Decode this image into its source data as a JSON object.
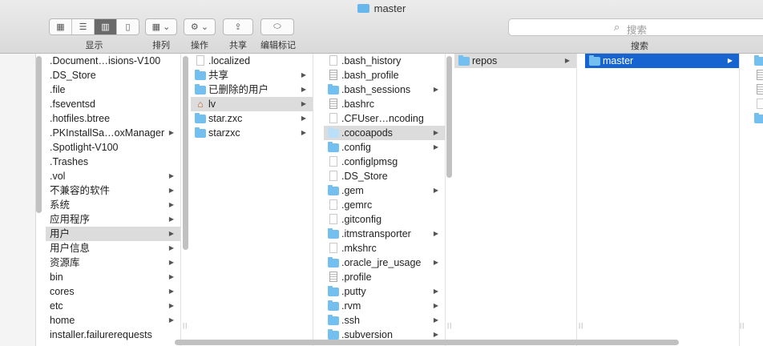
{
  "window": {
    "title": "master"
  },
  "toolbar": {
    "view_label": "显示",
    "arrange_label": "排列",
    "action_label": "操作",
    "share_label": "共享",
    "tags_label": "编辑标记",
    "search_placeholder": "搜索",
    "search_label": "搜索"
  },
  "columns": [
    {
      "items": [
        {
          "label": ".Document…isions-V100",
          "arrow": false
        },
        {
          "label": ".DS_Store",
          "arrow": false
        },
        {
          "label": ".file",
          "arrow": false
        },
        {
          "label": ".fseventsd",
          "arrow": false
        },
        {
          "label": ".hotfiles.btree",
          "arrow": false
        },
        {
          "label": ".PKInstallSa…oxManager",
          "arrow": true
        },
        {
          "label": ".Spotlight-V100",
          "arrow": false
        },
        {
          "label": ".Trashes",
          "arrow": false
        },
        {
          "label": ".vol",
          "arrow": true
        },
        {
          "label": "不兼容的软件",
          "arrow": true
        },
        {
          "label": "系统",
          "arrow": true
        },
        {
          "label": "应用程序",
          "arrow": true
        },
        {
          "label": "用户",
          "arrow": true,
          "state": "sel"
        },
        {
          "label": "用户信息",
          "arrow": true
        },
        {
          "label": "资源库",
          "arrow": true
        },
        {
          "label": "bin",
          "arrow": true
        },
        {
          "label": "cores",
          "arrow": true
        },
        {
          "label": "etc",
          "arrow": true
        },
        {
          "label": "home",
          "arrow": true
        },
        {
          "label": "installer.failurerequests",
          "arrow": false
        }
      ]
    },
    {
      "items": [
        {
          "label": ".localized",
          "icon": "file",
          "arrow": false
        },
        {
          "label": "共享",
          "icon": "folder",
          "arrow": true
        },
        {
          "label": "已删除的用户",
          "icon": "folder",
          "arrow": true
        },
        {
          "label": "lv",
          "icon": "home",
          "arrow": true,
          "state": "sel"
        },
        {
          "label": "star.zxc",
          "icon": "folder",
          "arrow": true
        },
        {
          "label": "starzxc",
          "icon": "folder",
          "arrow": true
        }
      ]
    },
    {
      "items": [
        {
          "label": ".bash_history",
          "icon": "file",
          "arrow": false
        },
        {
          "label": ".bash_profile",
          "icon": "doc",
          "arrow": false
        },
        {
          "label": ".bash_sessions",
          "icon": "folder",
          "arrow": true
        },
        {
          "label": ".bashrc",
          "icon": "doc",
          "arrow": false
        },
        {
          "label": ".CFUser…ncoding",
          "icon": "file",
          "arrow": false
        },
        {
          "label": ".cocoapods",
          "icon": "pale",
          "arrow": true,
          "state": "sel"
        },
        {
          "label": ".config",
          "icon": "folder",
          "arrow": true
        },
        {
          "label": ".configlpmsg",
          "icon": "file",
          "arrow": false
        },
        {
          "label": ".DS_Store",
          "icon": "file",
          "arrow": false
        },
        {
          "label": ".gem",
          "icon": "folder",
          "arrow": true
        },
        {
          "label": ".gemrc",
          "icon": "file",
          "arrow": false
        },
        {
          "label": ".gitconfig",
          "icon": "file",
          "arrow": false
        },
        {
          "label": ".itmstransporter",
          "icon": "folder",
          "arrow": true
        },
        {
          "label": ".mkshrc",
          "icon": "file",
          "arrow": false
        },
        {
          "label": ".oracle_jre_usage",
          "icon": "folder",
          "arrow": true
        },
        {
          "label": ".profile",
          "icon": "doc",
          "arrow": false
        },
        {
          "label": ".putty",
          "icon": "folder",
          "arrow": true
        },
        {
          "label": ".rvm",
          "icon": "folder",
          "arrow": true
        },
        {
          "label": ".ssh",
          "icon": "folder",
          "arrow": true
        },
        {
          "label": ".subversion",
          "icon": "folder",
          "arrow": true
        }
      ]
    },
    {
      "items": [
        {
          "label": "repos",
          "icon": "folder",
          "arrow": true,
          "state": "sel"
        }
      ]
    },
    {
      "items": [
        {
          "label": "master",
          "icon": "folder",
          "arrow": true,
          "state": "active"
        }
      ]
    }
  ],
  "column_icons": {
    "col6": [
      "folder",
      "doc",
      "doc",
      "file",
      "folder"
    ]
  }
}
